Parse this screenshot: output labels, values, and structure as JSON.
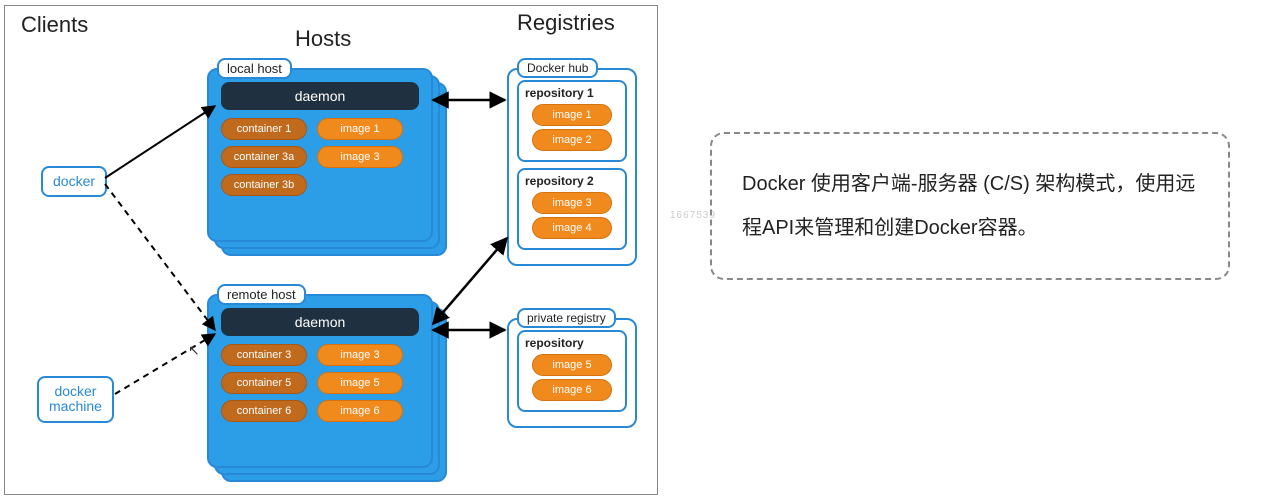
{
  "headers": {
    "clients": "Clients",
    "hosts": "Hosts",
    "registries": "Registries"
  },
  "clients": {
    "docker": "docker",
    "machine": "docker\nmachine"
  },
  "hosts": {
    "local": {
      "label": "local host",
      "daemon": "daemon",
      "containers": [
        "container 1",
        "container 3a",
        "container 3b"
      ],
      "images": [
        "image 1",
        "image 3"
      ]
    },
    "remote": {
      "label": "remote host",
      "daemon": "daemon",
      "containers": [
        "container 3",
        "container 5",
        "container 6"
      ],
      "images": [
        "image 3",
        "image 5",
        "image 6"
      ]
    }
  },
  "registries": {
    "hub": {
      "label": "Docker hub",
      "repos": [
        {
          "title": "repository 1",
          "images": [
            "image 1",
            "image 2"
          ]
        },
        {
          "title": "repository 2",
          "images": [
            "image 3",
            "image 4"
          ]
        }
      ]
    },
    "private": {
      "label": "private registry",
      "repos": [
        {
          "title": "repository",
          "images": [
            "image 5",
            "image 6"
          ]
        }
      ]
    }
  },
  "note": "Docker 使用客户端-服务器 (C/S) 架构模式，使用远程API来管理和创建Docker容器。",
  "watermark": "1667539",
  "colors": {
    "blue": "#2889d6",
    "blue_fill": "#2c9ee8",
    "daemon": "#1f3040",
    "container": "#c06a1e",
    "image": "#f08a1d"
  }
}
